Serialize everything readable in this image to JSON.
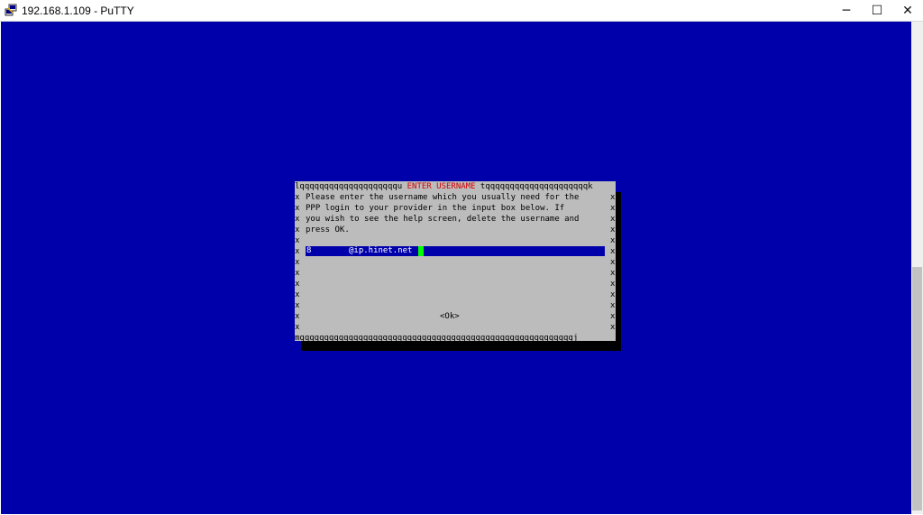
{
  "window": {
    "title": "192.168.1.109 - PuTTY",
    "minimize_glyph": "─",
    "maximize_glyph": "☐",
    "close_glyph": "✕"
  },
  "dialog": {
    "top_left": "lqqqqqqqqqqqqqqqqqqqqu",
    "title": " ENTER USERNAME ",
    "top_right": "tqqqqqqqqqqqqqqqqqqqqqk",
    "border_char": "x",
    "message": [
      "Please enter the username which you usually need for the",
      "PPP login to your provider in the input box below. If",
      "you wish to see the help screen, delete the username and",
      "press OK."
    ],
    "input_prefix": "8",
    "input_value": "@ip.hinet.net",
    "ok_label": "<Ok>",
    "bottom_border": "mqqqqqqqqqqqqqqqqqqqqqqqqqqqqqqqqqqqqqqqqqqqqqqqqqqqqqqqqj"
  },
  "colors": {
    "terminal_bg": "#0000aa",
    "dialog_bg": "#bcbcbc",
    "title_color": "#d40000",
    "cursor": "#00ff00"
  }
}
